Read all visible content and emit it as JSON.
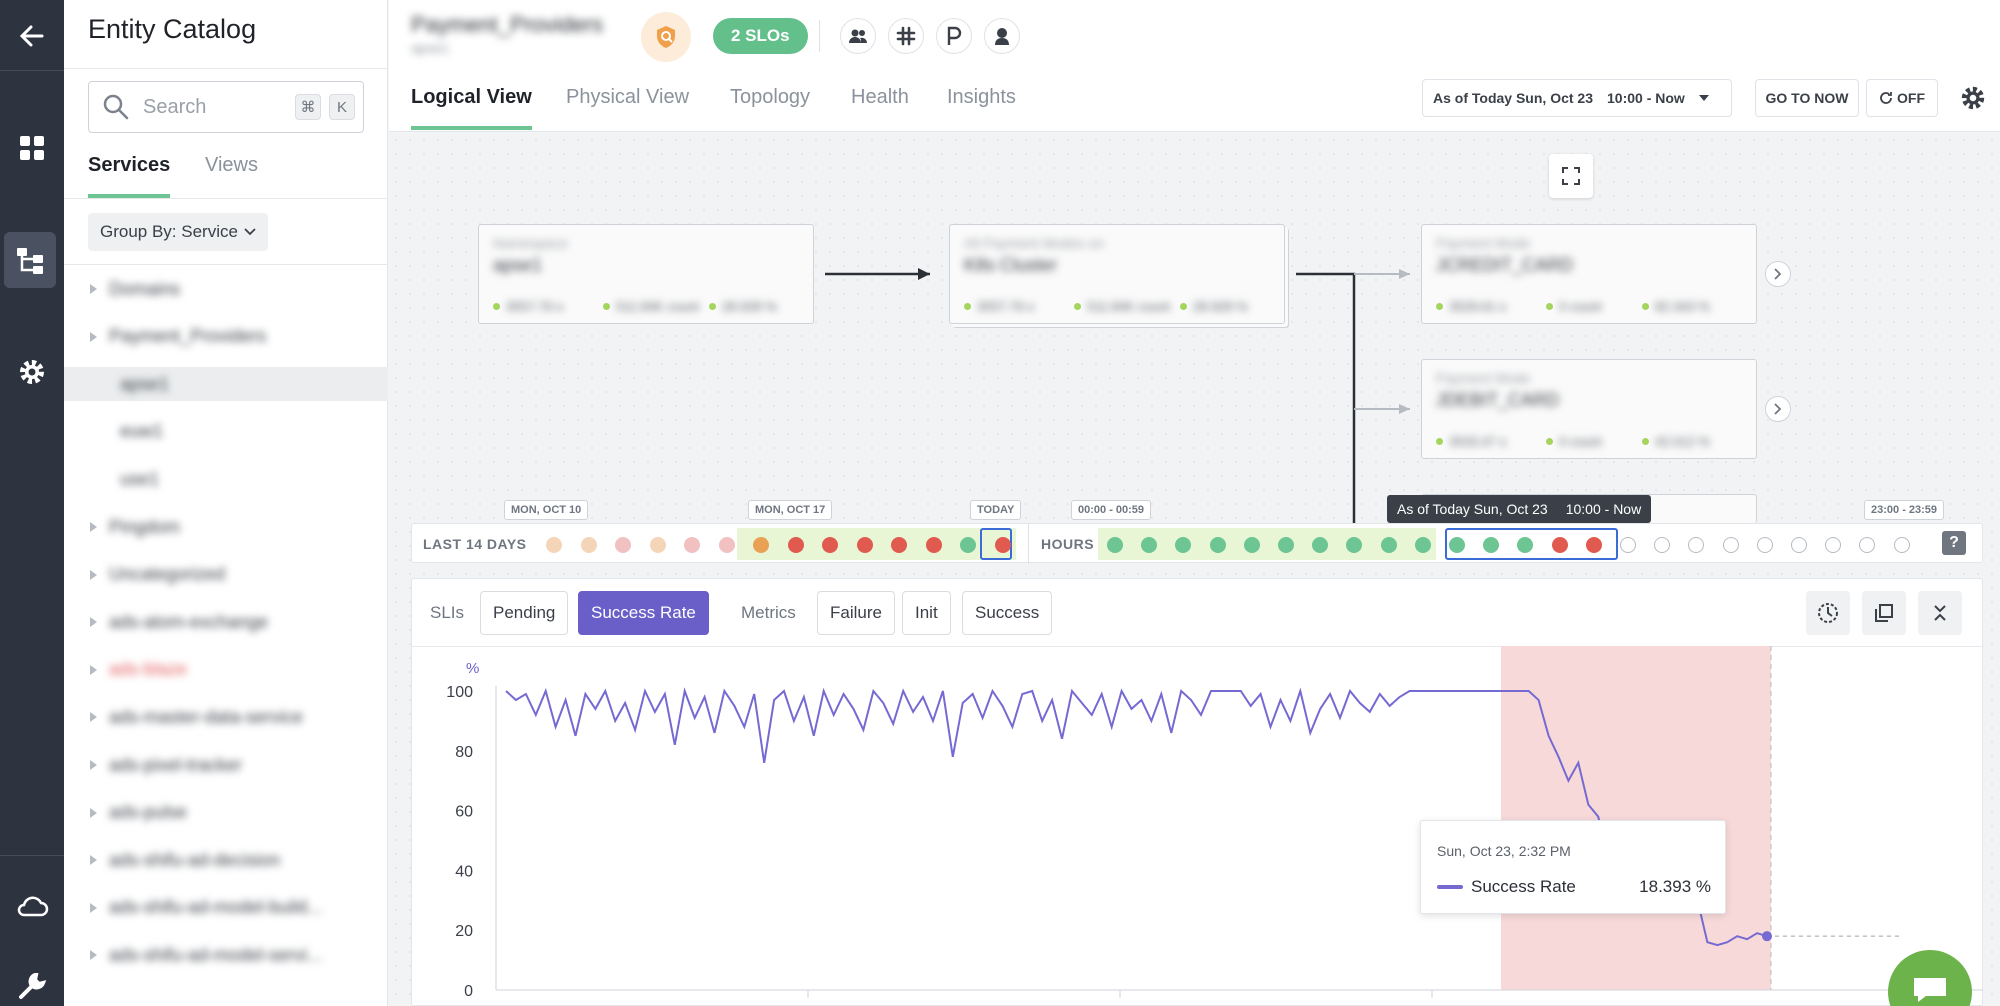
{
  "catalog": {
    "title": "Entity Catalog",
    "search_placeholder": "Search",
    "shortcut_keys": [
      "⌘",
      "K"
    ],
    "tabs": [
      "Services",
      "Views"
    ],
    "group_by": "Group By: Service",
    "tree": [
      {
        "label": "Domains",
        "blurred": true
      },
      {
        "label": "Payment_Providers",
        "blurred": true
      },
      {
        "label": "apse1",
        "blurred": true,
        "selected": true,
        "child": true
      },
      {
        "label": "euw1",
        "blurred": true,
        "child": true
      },
      {
        "label": "use1",
        "blurred": true,
        "child": true
      },
      {
        "label": "Pingdom",
        "blurred": true
      },
      {
        "label": "Uncategorized",
        "blurred": true
      },
      {
        "label": "ads-atom-exchange",
        "blurred": true
      },
      {
        "label": "ads-blaze",
        "blurred": true,
        "color": "#e35d5d"
      },
      {
        "label": "ads-master-data-service",
        "blurred": true
      },
      {
        "label": "ads-pixel-tracker",
        "blurred": true
      },
      {
        "label": "ads-pulse",
        "blurred": true
      },
      {
        "label": "ads-shifu-ad-decision",
        "blurred": true
      },
      {
        "label": "ads-shifu-ad-model-build...",
        "blurred": true
      },
      {
        "label": "ads-shifu-ad-model-servi...",
        "blurred": true
      }
    ]
  },
  "header": {
    "title": "Payment_Providers",
    "subtitle": "apse1",
    "slo_badge": "2 SLOs",
    "tabs": [
      "Logical View",
      "Physical View",
      "Topology",
      "Health",
      "Insights"
    ],
    "as_of_date": "As of Today Sun, Oct 23",
    "as_of_range": "10:00 - Now",
    "go_to_now": "GO TO NOW",
    "off": "OFF"
  },
  "nodes": [
    {
      "kind": "Namespace",
      "name": "apse1",
      "metrics": [
        "3557.76 s",
        "511.84K count",
        "28.928 %"
      ]
    },
    {
      "kind": "All Payment Modes on",
      "name": "K8s Cluster",
      "metrics": [
        "3557.76 s",
        "511.84K count",
        "28.928 %"
      ]
    },
    {
      "kind": "Payment Mode",
      "name": "JCREDIT_CARD",
      "metrics": [
        "3529.61 s",
        "0 count",
        "82.343 %"
      ]
    },
    {
      "kind": "Payment Mode",
      "name": "JDEBIT_CARD",
      "metrics": [
        "3533.47 s",
        "0 count",
        "42.012 %"
      ]
    }
  ],
  "timeline": {
    "last14_label": "LAST 14 DAYS",
    "hours_label": "HOURS",
    "tags": [
      "MON, OCT 10",
      "MON, OCT 17",
      "TODAY",
      "00:00 - 00:59",
      "23:00 - 23:59"
    ],
    "tooltip_date": "As of Today Sun, Oct 23",
    "tooltip_range": "10:00 - Now",
    "help": "?",
    "days": [
      "#f5d5b8",
      "#f5d5b8",
      "#f1c1c1",
      "#f5d5b8",
      "#f1c1c1",
      "#f1c1c1",
      "#e9a154",
      "#e05a4f",
      "#e05a4f",
      "#e05a4f",
      "#e05a4f",
      "#e05a4f",
      "#6cc592",
      "#e05a4f"
    ],
    "hours": [
      "#6cc592",
      "#6cc592",
      "#6cc592",
      "#6cc592",
      "#6cc592",
      "#6cc592",
      "#6cc592",
      "#6cc592",
      "#6cc592",
      "#6cc592",
      "#6cc592",
      "#6cc592",
      "#6cc592",
      "#e05a4f",
      "#e05a4f",
      "empty",
      "empty",
      "empty",
      "empty",
      "empty",
      "empty",
      "empty",
      "empty",
      "empty"
    ]
  },
  "panel": {
    "sli_label": "SLIs",
    "sli_buttons": [
      "Pending",
      "Success Rate"
    ],
    "metrics_label": "Metrics",
    "metric_buttons": [
      "Failure",
      "Init",
      "Success"
    ]
  },
  "chart_data": {
    "type": "line",
    "title": "",
    "ylabel": "%",
    "ylim": [
      0,
      100
    ],
    "yticks": [
      0,
      20,
      40,
      60,
      80,
      100
    ],
    "series": [
      {
        "name": "Success Rate",
        "color": "#7569d2",
        "values": [
          100,
          97,
          99,
          92,
          100,
          88,
          97,
          85,
          99,
          94,
          100,
          90,
          96,
          87,
          100,
          93,
          99,
          82,
          100,
          91,
          98,
          86,
          100,
          95,
          88,
          99,
          76,
          97,
          100,
          90,
          98,
          85,
          100,
          92,
          99,
          94,
          87,
          100,
          96,
          89,
          100,
          93,
          98,
          90,
          100,
          78,
          96,
          99,
          91,
          100,
          95,
          88,
          99,
          100,
          90,
          97,
          84,
          100,
          96,
          92,
          99,
          88,
          100,
          94,
          97,
          90,
          99,
          86,
          100,
          97,
          92,
          100,
          100,
          100,
          100,
          95,
          99,
          88,
          97,
          90,
          100,
          86,
          94,
          99,
          91,
          100,
          96,
          93,
          99,
          95,
          98,
          100,
          100,
          100,
          100,
          100,
          100,
          100,
          100,
          100,
          100,
          100,
          100,
          100,
          97,
          85,
          78,
          70,
          76,
          62,
          58,
          44,
          40,
          36,
          32,
          34,
          28,
          30,
          34,
          28,
          30,
          16,
          15,
          16,
          18,
          17,
          19,
          18
        ]
      }
    ],
    "tooltip": {
      "date": "Sun, Oct 23, 2:32 PM",
      "series": "Success Rate",
      "value": "18.393 %"
    }
  }
}
